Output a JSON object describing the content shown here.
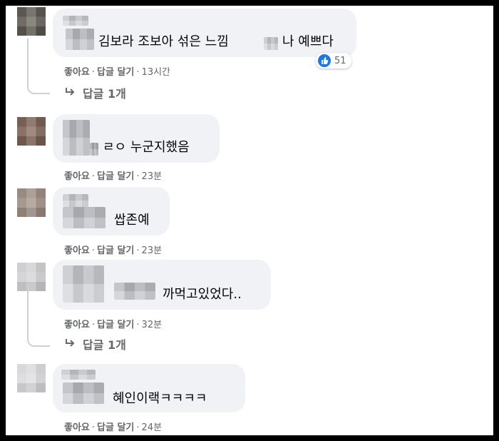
{
  "comments": [
    {
      "text_after": "김보라 조보아 섞은 느낌",
      "text_end": "나 예쁘다",
      "reaction_count": "51",
      "like_label": "좋아요",
      "reply_label": "답글 달기",
      "time": "13시간",
      "replies_link": "답글 1개"
    },
    {
      "text": "ㄹㅇ 누군지했음",
      "like_label": "좋아요",
      "reply_label": "답글 달기",
      "time": "23분"
    },
    {
      "text": "쌉존예",
      "like_label": "좋아요",
      "reply_label": "답글 달기",
      "time": "23분"
    },
    {
      "text": "까먹고있었다..",
      "like_label": "좋아요",
      "reply_label": "답글 달기",
      "time": "32분",
      "replies_link": "답글 1개"
    },
    {
      "text": "혜인이랙ㅋㅋㅋㅋ",
      "like_label": "좋아요",
      "reply_label": "답글 달기",
      "time": "24분"
    }
  ],
  "colors": {
    "bubble": "#f0f2f5",
    "meta_text": "#65676b",
    "like_blue": "#1877f2",
    "thread_line": "#ced0d4"
  },
  "icons": {
    "reaction": "thumbs-up-icon",
    "reply_arrow": "reply-arrow-icon"
  }
}
